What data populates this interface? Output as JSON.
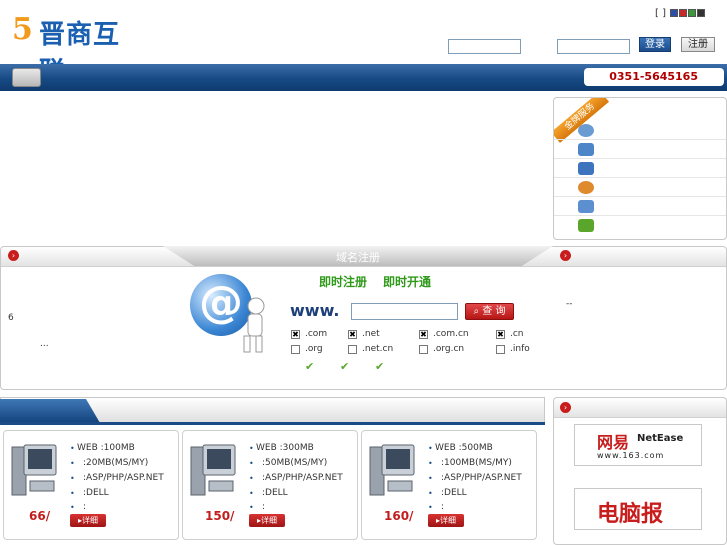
{
  "header": {
    "logo_five": "5",
    "logo_text": "晋商互联",
    "lang_brackets": "[      ]",
    "login_button": "登录",
    "register_button": "注册"
  },
  "nav": {
    "hotline": "0351-5645165"
  },
  "service": {
    "ribbon": "金牌服务",
    "icon_colors": [
      "#6a9bd1",
      "#4c86c8",
      "#3d74bd",
      "#e08a2e",
      "#5c8fcf",
      "#5aa62a"
    ]
  },
  "domain": {
    "title": "域名注册",
    "slogan_1": "即时注册",
    "slogan_2": "即时开通",
    "www": "www.",
    "query_button": "查 询",
    "left_text_1": "6",
    "left_text_2": "...",
    "right_text": "--",
    "tlds": [
      {
        "label": ".com",
        "checked": true
      },
      {
        "label": ".net",
        "checked": true
      },
      {
        "label": ".com.cn",
        "checked": true
      },
      {
        "label": ".cn",
        "checked": true
      },
      {
        "label": ".org",
        "checked": false
      },
      {
        "label": ".net.cn",
        "checked": false
      },
      {
        "label": ".org.cn",
        "checked": false
      },
      {
        "label": ".info",
        "checked": false
      }
    ]
  },
  "hosting": {
    "plans": [
      {
        "lines": [
          "WEB :100MB",
          ":20MB(MS/MY)",
          ":ASP/PHP/ASP.NET",
          ":DELL",
          ":"
        ],
        "price": "66/",
        "detail": "详细"
      },
      {
        "lines": [
          "WEB :300MB",
          ":50MB(MS/MY)",
          ":ASP/PHP/ASP.NET",
          ":DELL",
          ":"
        ],
        "price": "150/",
        "detail": "详细"
      },
      {
        "lines": [
          "WEB :500MB",
          ":100MB(MS/MY)",
          ":ASP/PHP/ASP.NET",
          ":DELL",
          ":"
        ],
        "price": "160/",
        "detail": "详细"
      }
    ]
  },
  "partners": {
    "netease_cn": "网易",
    "netease_en": "NetEase",
    "netease_url": "www.163.com",
    "diannaobao": "电脑报"
  }
}
